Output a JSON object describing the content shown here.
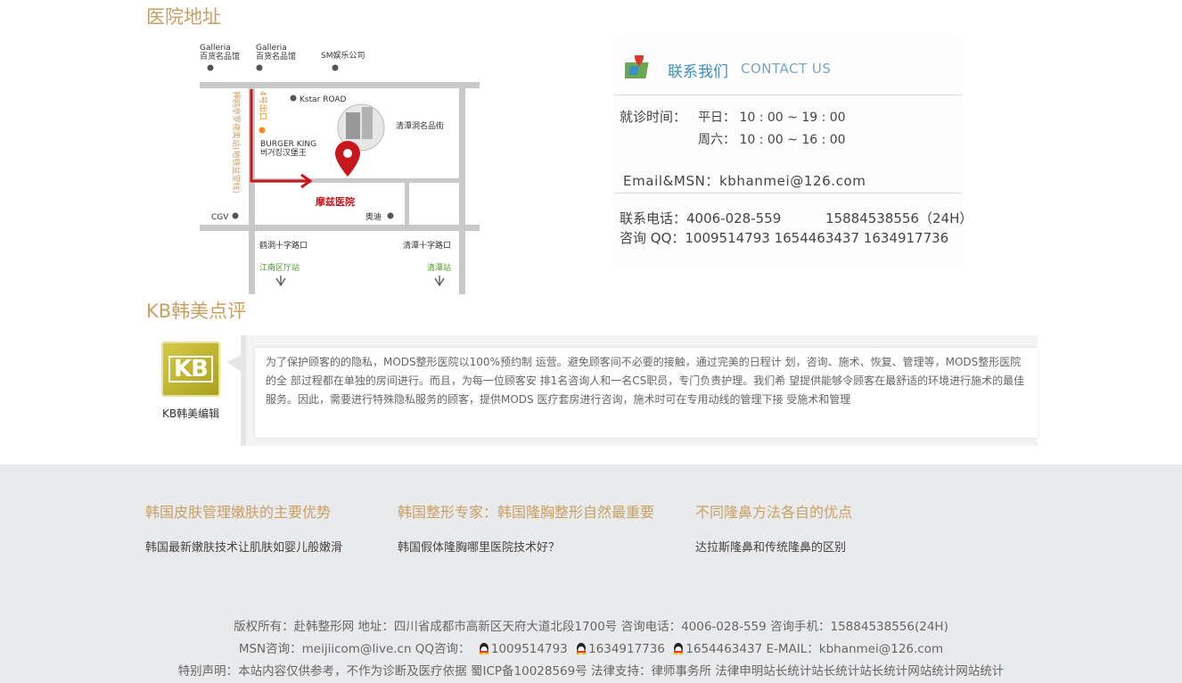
{
  "sections": {
    "address_title": "医院地址",
    "review_title": "KB韩美点评"
  },
  "map": {
    "galleria1_a": "Galleria",
    "galleria1_b": "百货名品馆",
    "galleria2_a": "Galleria",
    "galleria2_b": "百货名品馆",
    "sm": "SM娱乐公司",
    "kstar": "Kstar ROAD",
    "exit4": "4号出口",
    "station": "狎鸥亭罗德奥站(地铁盆堂线)",
    "burger_a": "BURGER KING",
    "burger_b": "버거킹汉堡王",
    "street": "清潭洞名品街",
    "hospital": "摩兹医院",
    "cgv": "CGV",
    "audi": "奥迪",
    "cross1": "鹤洞十字路口",
    "cross2": "清潭十字路口",
    "gangnam": "江南区厅站",
    "cheongdam": "清潭站"
  },
  "contact": {
    "title_zh": "联系我们",
    "title_en": "CONTACT US",
    "hours_label": "就诊时间：",
    "weekday": "平日： 10 : 00 ~ 19 : 00",
    "saturday": "周六： 10 : 00 ~ 16 : 00",
    "email": "Email&MSN：kbhanmei@126.com",
    "phone": "联系电话：4006-028-559",
    "mobile": "15884538556（24H）",
    "qq": "咨询 QQ：1009514793  1654463437   1634917736"
  },
  "review": {
    "logo_text": "KB",
    "caption": "KB韩美编辑",
    "text": "为了保护顾客的的隐私，MODS整形医院以100%预约制 运营。避免顾客间不必要的接触，通过完美的日程计 划，咨询、施术、恢复、管理等，MODS整形医院的全 部过程都在单独的房间进行。而且，为每一位顾客安 排1名咨询人和一名CS职员，专门负责护理。我们希 望提供能够令顾客在最舒适的环境进行施术的最佳服务。因此，需要进行特殊隐私服务的顾客，提供MODS 医疗套房进行咨询，施术时可在专用动线的管理下接 受施术和管理"
  },
  "footer": {
    "col1_title": "韩国皮肤管理嫩肤的主要优势",
    "col1_link": "韩国最新嫩肤技术让肌肤如婴儿般嫩滑",
    "col2_title": "韩国整形专家：韩国隆胸整形自然最重要",
    "col2_link": "韩国假体隆胸哪里医院技术好？",
    "col3_title": "不同隆鼻方法各自的优点",
    "col3_link": "达拉斯隆鼻和传统隆鼻的区别",
    "line1": "版权所有：赴韩整形网 地址：四川省成都市高新区天府大道北段1700号 咨询电话：4006-028-559 咨询手机：15884538556(24H)",
    "msn": "MSN咨询：meijiicom@live.cn QQ咨询：",
    "qq1": "1009514793",
    "qq2": "1634917736",
    "qq3": "1654463437",
    "email": "E-MAIL：kbhanmei@126.com",
    "line3": "特别声明：本站内容仅供参考，不作为诊断及医疗依据 蜀ICP备10028569号 法律支持：律师事务所 法律申明站长统计站长统计站长统计网站统计网站统计"
  },
  "colors": {
    "accent": "#c9a063",
    "footer_bg": "#e9eaec",
    "map_red": "#c8161d",
    "contact_blue": "#3a8fc4"
  }
}
